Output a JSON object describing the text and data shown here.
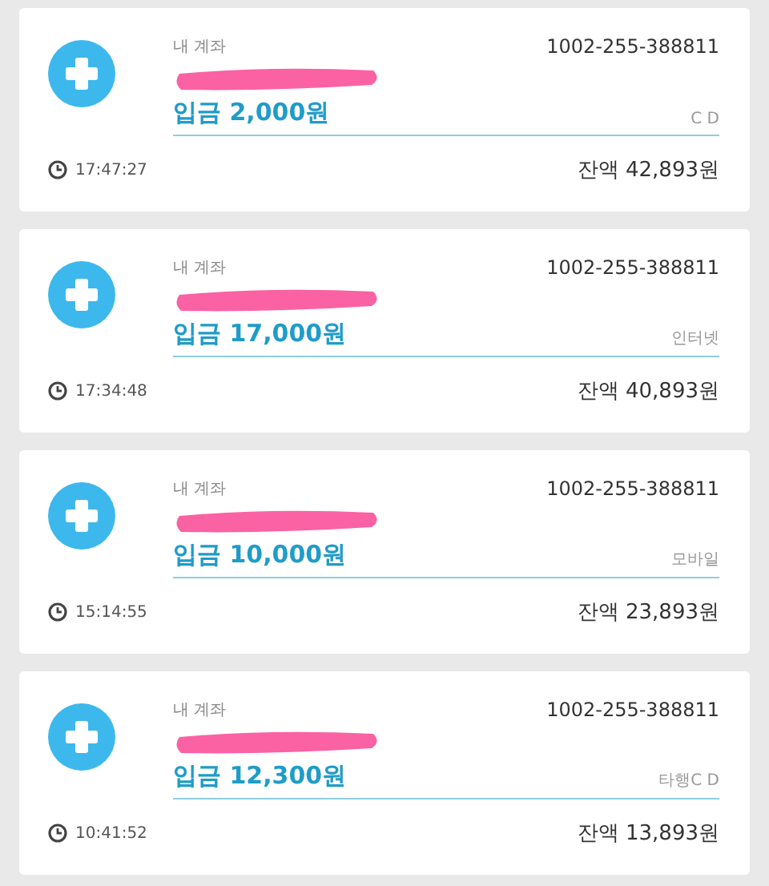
{
  "transactions": [
    {
      "account_label": "내 계좌",
      "account_number": "1002-255-388811",
      "amount": "입금 2,000원",
      "channel": "C D",
      "time": "17:47:27",
      "balance": "잔액 42,893원"
    },
    {
      "account_label": "내 계좌",
      "account_number": "1002-255-388811",
      "amount": "입금 17,000원",
      "channel": "인터넷",
      "time": "17:34:48",
      "balance": "잔액 40,893원"
    },
    {
      "account_label": "내 계좌",
      "account_number": "1002-255-388811",
      "amount": "입금 10,000원",
      "channel": "모바일",
      "time": "15:14:55",
      "balance": "잔액 23,893원"
    },
    {
      "account_label": "내 계좌",
      "account_number": "1002-255-388811",
      "amount": "입금 12,300원",
      "channel": "타행C D",
      "time": "10:41:52",
      "balance": "잔액 13,893원"
    }
  ]
}
